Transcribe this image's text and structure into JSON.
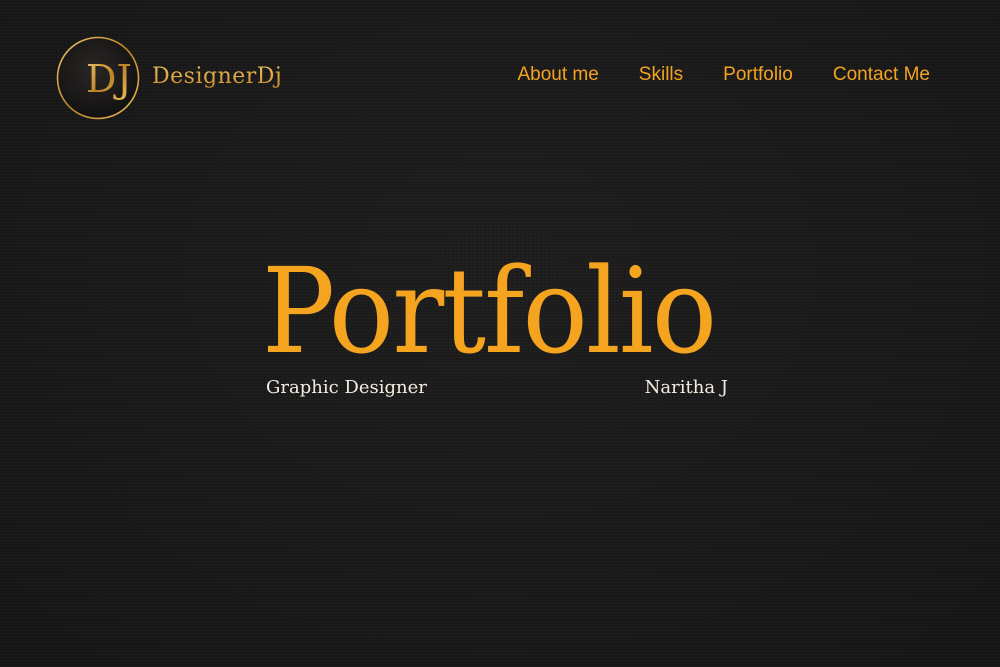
{
  "brand": {
    "monogram": "DJ",
    "name": "DesignerDj"
  },
  "nav": {
    "items": [
      {
        "label": "About me"
      },
      {
        "label": "Skills"
      },
      {
        "label": "Portfolio"
      },
      {
        "label": "Contact Me"
      }
    ]
  },
  "hero": {
    "title": "Portfolio",
    "role": "Graphic Designer",
    "author": "Naritha J"
  },
  "colors": {
    "background": "#1a1919",
    "accent": "#f5a41f",
    "gold": "#d9a53a",
    "subtitle": "#f4ece0"
  }
}
